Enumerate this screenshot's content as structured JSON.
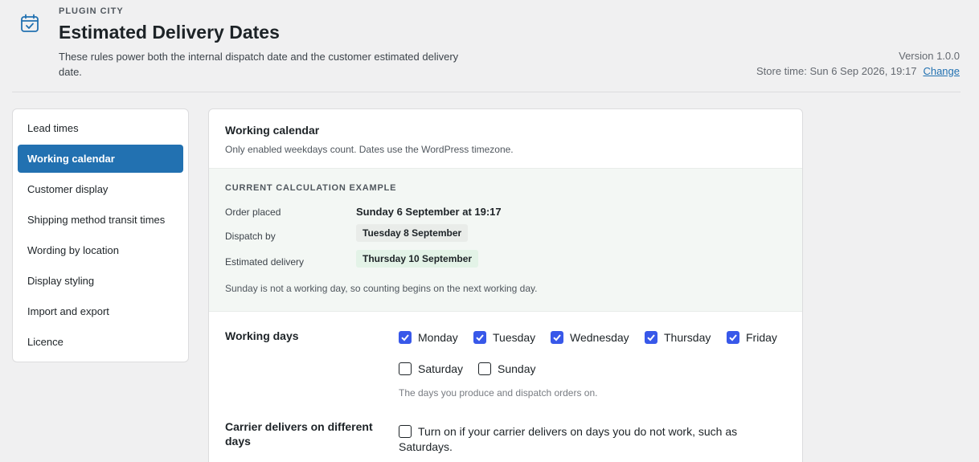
{
  "header": {
    "brand": "PLUGIN CITY",
    "title": "Estimated Delivery Dates",
    "subtitle": "These rules power both the internal dispatch date and the customer estimated delivery date.",
    "version": "Version 1.0.0",
    "store_time": "Store time: Sun 6 Sep 2026, 19:17",
    "change_link": "Change",
    "icon": "calendar-check-icon"
  },
  "sidebar": {
    "items": [
      {
        "label": "Lead times",
        "active": false
      },
      {
        "label": "Working calendar",
        "active": true
      },
      {
        "label": "Customer display",
        "active": false
      },
      {
        "label": "Shipping method transit times",
        "active": false
      },
      {
        "label": "Wording by location",
        "active": false
      },
      {
        "label": "Display styling",
        "active": false
      },
      {
        "label": "Import and export",
        "active": false
      },
      {
        "label": "Licence",
        "active": false
      }
    ]
  },
  "card": {
    "title": "Working calendar",
    "subtitle": "Only enabled weekdays count. Dates use the WordPress timezone."
  },
  "calculation": {
    "heading": "CURRENT CALCULATION EXAMPLE",
    "order_placed_label": "Order placed",
    "order_placed_value": "Sunday 6 September at 19:17",
    "dispatch_label": "Dispatch by",
    "dispatch_value": "Tuesday 8 September",
    "delivery_label": "Estimated delivery",
    "delivery_value": "Thursday 10 September",
    "note": "Sunday is not a working day, so counting begins on the next working day."
  },
  "working_days": {
    "label": "Working days",
    "days": [
      {
        "label": "Monday",
        "checked": true
      },
      {
        "label": "Tuesday",
        "checked": true
      },
      {
        "label": "Wednesday",
        "checked": true
      },
      {
        "label": "Thursday",
        "checked": true
      },
      {
        "label": "Friday",
        "checked": true
      },
      {
        "label": "Saturday",
        "checked": false
      },
      {
        "label": "Sunday",
        "checked": false
      }
    ],
    "help": "The days you produce and dispatch orders on."
  },
  "carrier": {
    "label": "Carrier delivers on different days",
    "checkbox_label": "Turn on if your carrier delivers on days you do not work, such as Saturdays.",
    "checked": false
  },
  "colors": {
    "accent": "#2271b1",
    "checkbox": "#3858e9",
    "calc_bg": "#f3f7f4"
  }
}
